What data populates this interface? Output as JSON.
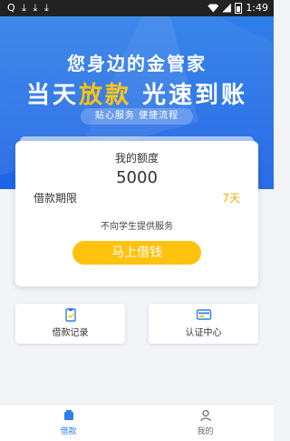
{
  "statusbar": {
    "left_icons": "Q ⤓ ⤓ ⤓",
    "time": "1:49"
  },
  "banner": {
    "line1": "您身边的金管家",
    "line2_part1": "当天",
    "line2_part2": "放款",
    "line2_part3": " 光速到账",
    "tagline": "贴心服务  便捷流程"
  },
  "card": {
    "quota_label": "我的额度",
    "quota_value": "5000",
    "term_label": "借款期限",
    "term_value": "7天",
    "notice": "不向学生提供服务",
    "borrow_button": "马上借钱"
  },
  "tiles": [
    {
      "label": "借款记录",
      "icon": "clipboard-check-icon"
    },
    {
      "label": "认证中心",
      "icon": "id-card-icon"
    }
  ],
  "tabbar": {
    "tabs": [
      {
        "label": "借款",
        "icon": "home-icon",
        "active": true
      },
      {
        "label": "我的",
        "icon": "person-icon",
        "active": false
      }
    ]
  },
  "colors": {
    "accent_blue": "#2f7fe8",
    "accent_yellow": "#ffc20e"
  }
}
